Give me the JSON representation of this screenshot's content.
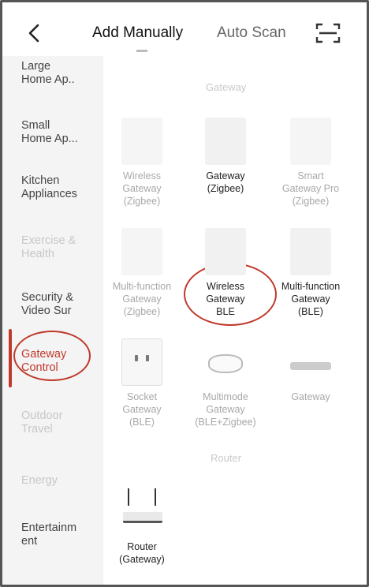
{
  "header": {
    "tab_active": "Add Manually",
    "tab_inactive": "Auto Scan"
  },
  "sidebar": {
    "items": [
      {
        "label": "Large\nHome Ap..",
        "state": "normal"
      },
      {
        "label": "Small\nHome Ap...",
        "state": "normal"
      },
      {
        "label": "Kitchen\nAppliances",
        "state": "normal"
      },
      {
        "label": "Exercise &\nHealth",
        "state": "faded"
      },
      {
        "label": "Security &\nVideo Sur",
        "state": "normal"
      },
      {
        "label": "Gateway\nControl",
        "state": "active"
      },
      {
        "label": "Outdoor\nTravel",
        "state": "faded"
      },
      {
        "label": "Energy",
        "state": "faded"
      },
      {
        "label": "Entertainm\nent",
        "state": "normal"
      }
    ]
  },
  "sections": {
    "gateway_title": "Gateway",
    "router_title": "Router"
  },
  "devices": [
    {
      "name": "Wireless\nGateway\n(Zigbee)",
      "state": "faded"
    },
    {
      "name": "Gateway\n(Zigbee)",
      "state": "normal"
    },
    {
      "name": "Smart\nGateway Pro\n(Zigbee)",
      "state": "faded"
    },
    {
      "name": "Multi-function\nGateway\n(Zigbee)",
      "state": "faded"
    },
    {
      "name": "Wireless\nGateway\nBLE",
      "state": "normal"
    },
    {
      "name": "Multi-function\nGateway\n(BLE)",
      "state": "normal"
    },
    {
      "name": "Socket\nGateway\n(BLE)",
      "state": "faded"
    },
    {
      "name": "Multimode\nGateway\n(BLE+Zigbee)",
      "state": "faded"
    },
    {
      "name": "Gateway",
      "state": "faded"
    },
    {
      "name": "Router\n(Gateway)",
      "state": "normal"
    }
  ],
  "icons": {
    "back": "chevron-left-icon",
    "scan": "scan-frame-icon"
  },
  "colors": {
    "accent": "#c0392b",
    "sidebar_bg": "#f4f4f4"
  }
}
